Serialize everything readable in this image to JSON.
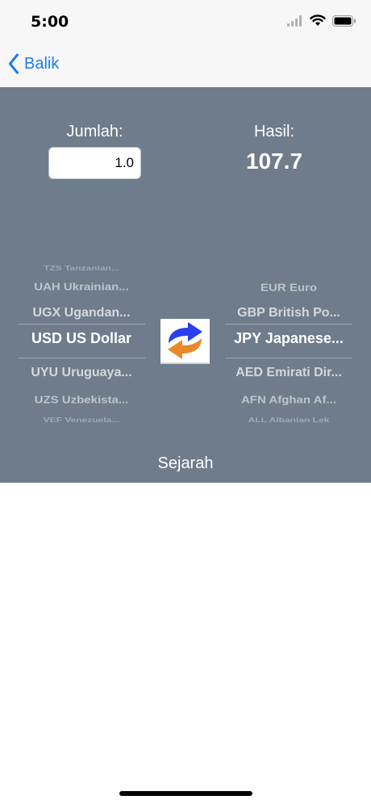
{
  "status_bar": {
    "time": "5:00",
    "signal_icon": "signal-icon",
    "wifi_icon": "wifi-icon",
    "battery_icon": "battery-icon"
  },
  "nav": {
    "back_label": "Balik",
    "back_icon": "chevron-left-icon"
  },
  "converter": {
    "amount_label": "Jumlah:",
    "amount_value": "1.0",
    "result_label": "Hasil:",
    "result_value": "107.7",
    "swap_icon": "swap-arrows-icon"
  },
  "from_picker": {
    "rows": [
      "TZS Tanzanian...",
      "UAH Ukrainian...",
      "UGX Ugandan...",
      "USD US Dollar",
      "UYU Uruguaya...",
      "UZS Uzbekista...",
      "VEF Venezuela..."
    ],
    "selected": "USD US Dollar"
  },
  "to_picker": {
    "rows": [
      "EUR Euro",
      "GBP British Po...",
      "JPY Japanese...",
      "AED Emirati Dir...",
      "AFN Afghan Af...",
      "ALL Albanian Lek"
    ],
    "selected": "JPY Japanese..."
  },
  "history_label": "Sejarah",
  "colors": {
    "panel": "#6e7c8b",
    "accent": "#1a7ff0",
    "swap_blue": "#2a3ff0",
    "swap_orange": "#e88a2a"
  }
}
